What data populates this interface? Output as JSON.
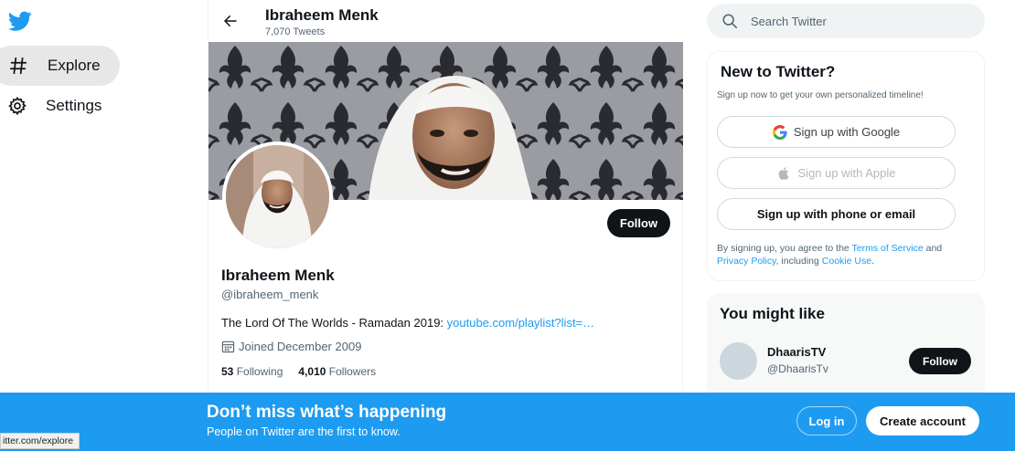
{
  "nav": {
    "items": [
      {
        "label": "Explore",
        "icon": "hashtag-icon",
        "active": true
      },
      {
        "label": "Settings",
        "icon": "gear-icon",
        "active": false
      }
    ]
  },
  "header": {
    "name": "Ibraheem Menk",
    "tweet_count": "7,070 Tweets"
  },
  "profile": {
    "follow_label": "Follow",
    "name": "Ibraheem Menk",
    "handle": "@ibraheem_menk",
    "bio_text": "The Lord Of The Worlds - Ramadan 2019: ",
    "bio_link": "youtube.com/playlist?list=…",
    "joined": "Joined December 2009",
    "following_count": "53",
    "following_label": "Following",
    "followers_count": "4,010",
    "followers_label": "Followers"
  },
  "search": {
    "placeholder": "Search Twitter"
  },
  "new_to_twitter": {
    "title": "New to Twitter?",
    "subtitle": "Sign up now to get your own personalized timeline!",
    "google_label": "Sign up with Google",
    "apple_label": "Sign up with Apple",
    "phone_label": "Sign up with phone or email",
    "terms_pre": "By signing up, you agree to the ",
    "terms_link": "Terms of Service",
    "terms_and": " and ",
    "privacy_link": "Privacy Policy",
    "terms_mid": ", including ",
    "cookie_link": "Cookie Use",
    "terms_end": "."
  },
  "might_like": {
    "title": "You might like",
    "suggestions": [
      {
        "name": "DhaarisTV",
        "handle": "@DhaarisTv",
        "follow_label": "Follow"
      }
    ]
  },
  "bottom_bar": {
    "title": "Don’t miss what’s happening",
    "subtitle": "People on Twitter are the first to know.",
    "login_label": "Log in",
    "create_label": "Create account"
  },
  "status_url": "itter.com/explore",
  "colors": {
    "accent": "#1d9bf0",
    "dark_button": "#0f1419",
    "muted_text": "#536471"
  }
}
